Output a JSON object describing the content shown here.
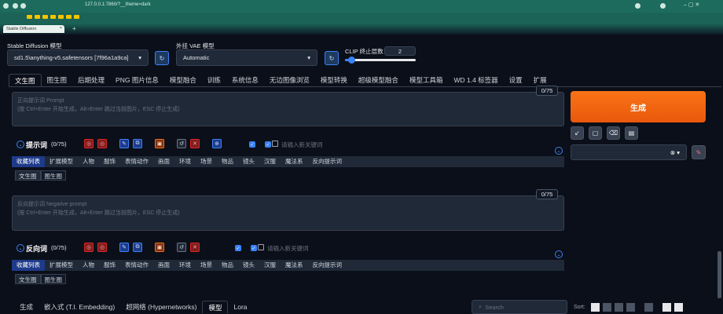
{
  "browser": {
    "url": "127.0.0.1:7860/?__theme=dark",
    "tab_title": "Stable Diffusion",
    "tab_close": "×",
    "new_tab": "+"
  },
  "settings": {
    "model_label": "Stable Diffusion 模型",
    "model_value": "sd1.5\\anything-v5.safetensors [7f96a1a9ca]",
    "vae_label": "外挂 VAE 模型",
    "vae_value": "Automatic",
    "clip_label": "CLIP 终止层数",
    "clip_value": "2",
    "clip_fraction": 0.09
  },
  "main_tabs": [
    "文生图",
    "图生图",
    "后期处理",
    "PNG 图片信息",
    "模型融合",
    "训练",
    "系统信息",
    "无边图像浏览",
    "模型转换",
    "超级模型融合",
    "模型工具箱",
    "WD 1.4 标签器",
    "设置",
    "扩展"
  ],
  "prompt": {
    "placeholder_line1": "正向提示词 Prompt",
    "placeholder_line2": "(按 Ctrl+Enter 开始生成，Alt+Enter 跳过当前图片，ESC 停止生成)",
    "counter": "0/75"
  },
  "negative": {
    "placeholder_line1": "反向提示词 Negative prompt",
    "placeholder_line2": "(按 Ctrl+Enter 开始生成，Alt+Enter 跳过当前图片，ESC 停止生成)",
    "counter": "0/75"
  },
  "generate_label": "生成",
  "prompt_helper": {
    "title": "提示词",
    "count": "(0/75)",
    "keyword_placeholder": "请输入新关键词",
    "categories": [
      "收藏列表",
      "扩展模型",
      "人物",
      "服饰",
      "表情动作",
      "画面",
      "环境",
      "场景",
      "物品",
      "镜头",
      "汉服",
      "魔法系",
      "反向提示词"
    ],
    "sub_tabs": [
      "文生图",
      "图生图"
    ]
  },
  "neg_helper": {
    "title": "反向词",
    "count": "(0/75)",
    "keyword_placeholder": "请输入新关键词",
    "categories": [
      "收藏列表",
      "扩展模型",
      "人物",
      "服饰",
      "表情动作",
      "画面",
      "环境",
      "场景",
      "物品",
      "镜头",
      "汉服",
      "魔法系",
      "反向提示词"
    ],
    "sub_tabs": [
      "文生图",
      "图生图"
    ]
  },
  "extra_tabs": [
    "生成",
    "嵌入式 (T.I. Embedding)",
    "超网络 (Hypernetworks)",
    "模型",
    "Lora"
  ],
  "search_placeholder": "Search",
  "sort_label": "Sort:",
  "colors": {
    "accent": "#f97316",
    "blue": "#3b82f6",
    "bg": "#0b0f19"
  }
}
